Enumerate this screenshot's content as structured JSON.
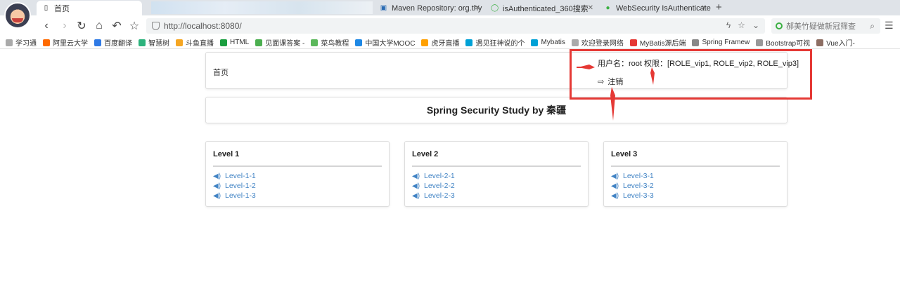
{
  "browser": {
    "tabs": [
      {
        "label": "首页",
        "active": true
      },
      {
        "label": "Maven Repository: org.thy"
      },
      {
        "label": "isAuthenticated_360搜索"
      },
      {
        "label": "WebSecurity IsAuthenticate"
      }
    ],
    "url": "http://localhost:8080/",
    "search_placeholder": "郝美竹疑做新冠筛查",
    "bookmarks": [
      {
        "label": "学习通",
        "color": "#aaaaaa"
      },
      {
        "label": "阿里云大学",
        "color": "#ff6a00"
      },
      {
        "label": "百度翻译",
        "color": "#2f7ae5"
      },
      {
        "label": "智慧树",
        "color": "#2db37d"
      },
      {
        "label": "斗鱼直播",
        "color": "#f5a623"
      },
      {
        "label": "HTML",
        "color": "#1a9e3f"
      },
      {
        "label": "见面课答案 -",
        "color": "#4caf50"
      },
      {
        "label": "菜鸟教程",
        "color": "#5cb85c"
      },
      {
        "label": "中国大学MOOC",
        "color": "#1e88e5"
      },
      {
        "label": "虎牙直播",
        "color": "#ffa000"
      },
      {
        "label": "遇见狂神说的个",
        "color": "#00a1d6"
      },
      {
        "label": "Mybatis",
        "color": "#00a1d6"
      },
      {
        "label": "欢迎登录网络",
        "color": "#aaaaaa"
      },
      {
        "label": "MyBatis源后端",
        "color": "#e53935"
      },
      {
        "label": "Spring Framew",
        "color": "#888888"
      },
      {
        "label": "Bootstrap可视",
        "color": "#999999"
      },
      {
        "label": "Vue入门-",
        "color": "#8d6e63"
      }
    ]
  },
  "nav": {
    "home": "首页",
    "user_info": "用户名：root 权限：[ROLE_vip1, ROLE_vip2, ROLE_vip3]",
    "logout": "注销"
  },
  "title": "Spring Security Study by 秦疆",
  "levels": [
    {
      "title": "Level 1",
      "links": [
        "Level-1-1",
        "Level-1-2",
        "Level-1-3"
      ]
    },
    {
      "title": "Level 2",
      "links": [
        "Level-2-1",
        "Level-2-2",
        "Level-2-3"
      ]
    },
    {
      "title": "Level 3",
      "links": [
        "Level-3-1",
        "Level-3-2",
        "Level-3-3"
      ]
    }
  ],
  "colors": {
    "link": "#4183c4",
    "annotation": "#e53935"
  }
}
